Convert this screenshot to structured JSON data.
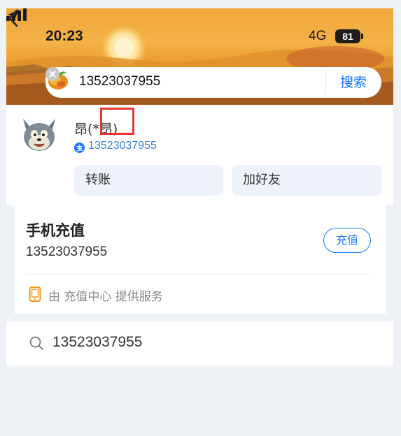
{
  "status_bar": {
    "time": "20:23",
    "network": "4G",
    "battery": "81"
  },
  "search": {
    "query": "13523037955",
    "button_label": "搜索"
  },
  "contact": {
    "name": "昂(*昂)",
    "phone": "13523037955",
    "actions": [
      "转账",
      "加好友"
    ]
  },
  "recharge": {
    "title": "手机充值",
    "phone": "13523037955",
    "button_label": "充值",
    "provider_text": "由 充值中心 提供服务"
  },
  "suggestion": {
    "text": "13523037955"
  },
  "colors": {
    "accent": "#1677ff",
    "highlight_box": "#e8332f",
    "banner_orange": "#f0a63a"
  }
}
